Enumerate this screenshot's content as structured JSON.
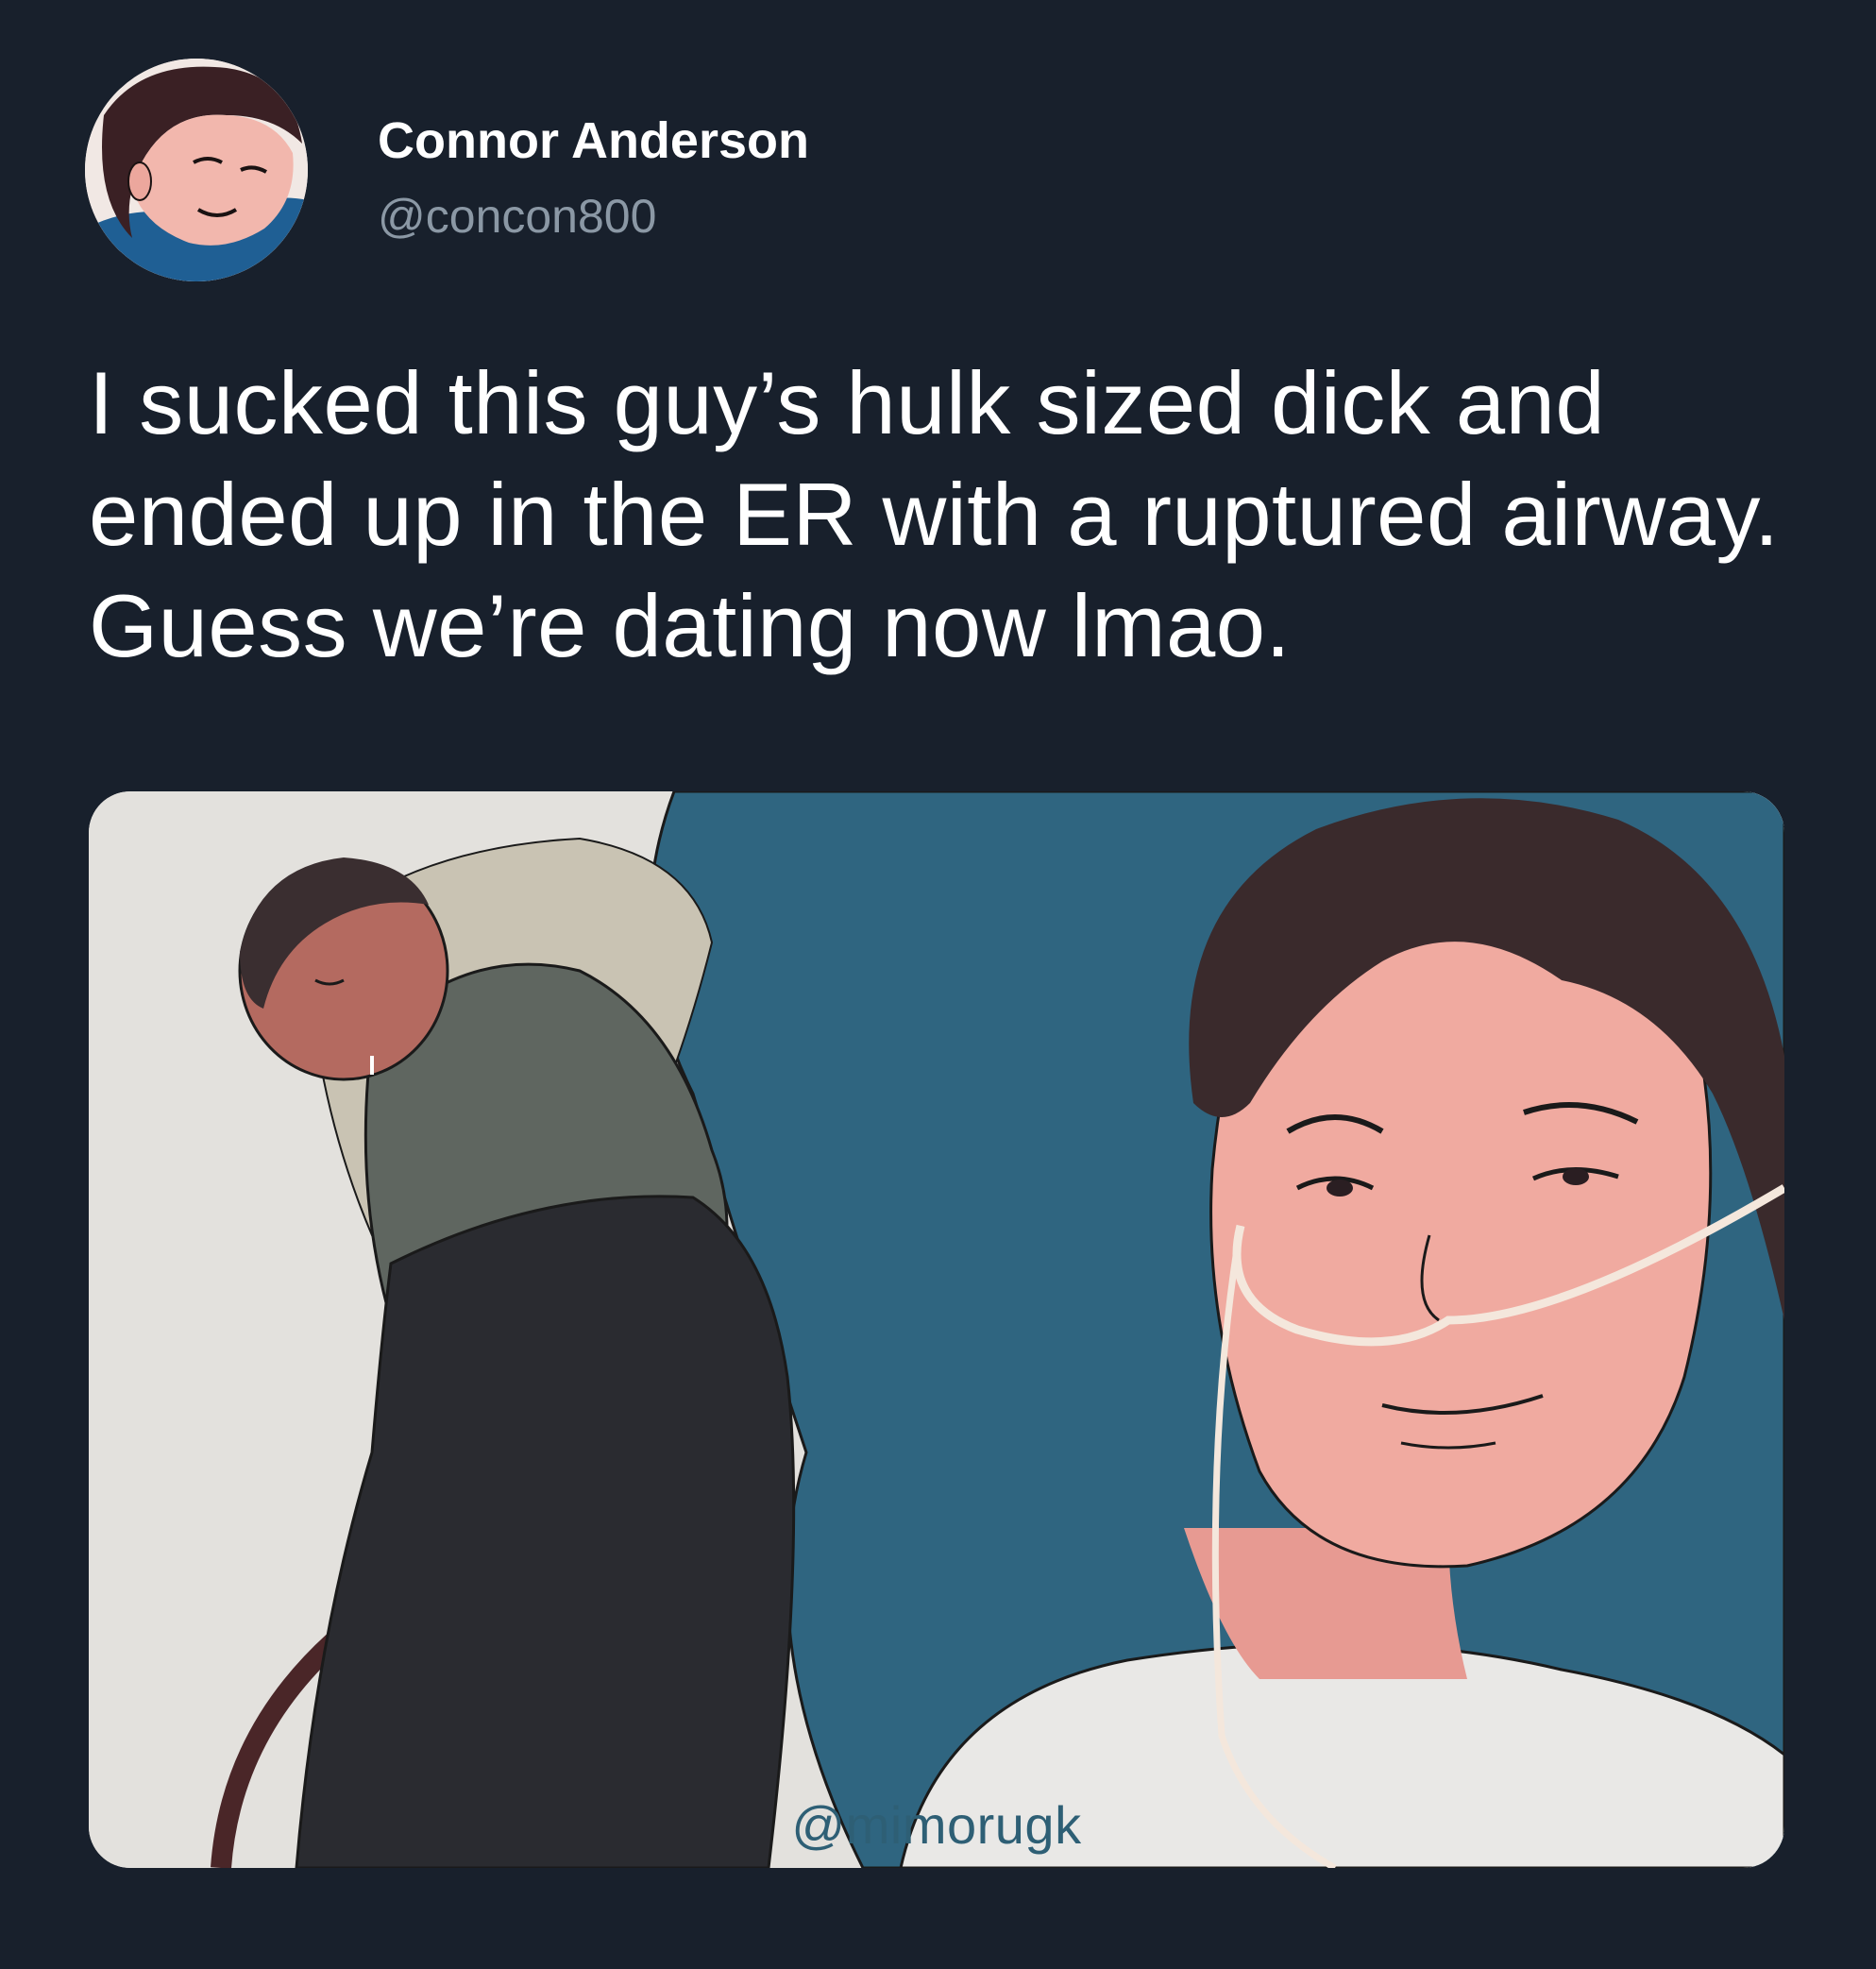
{
  "tweet": {
    "display_name": "Connor Anderson",
    "handle": "@concon800",
    "text": "I sucked this guy’s hulk sized dick and ended up in the ER with a ruptured airway. Guess we’re dating now lmao.",
    "avatar_icon": "profile-photo-icon"
  },
  "media": {
    "watermark": "@mimorugk"
  },
  "colors": {
    "background": "#18202c",
    "name": "#ffffff",
    "handle": "#8b98a5",
    "text": "#ffffff",
    "pillow": "#2f6580",
    "wall": "#e3e1dd",
    "skin": "#f0aaa0",
    "hair": "#3a2a2c",
    "sweater": "#5f6660",
    "blanket": "#2a2b30",
    "watermark": "#2e5f75"
  }
}
